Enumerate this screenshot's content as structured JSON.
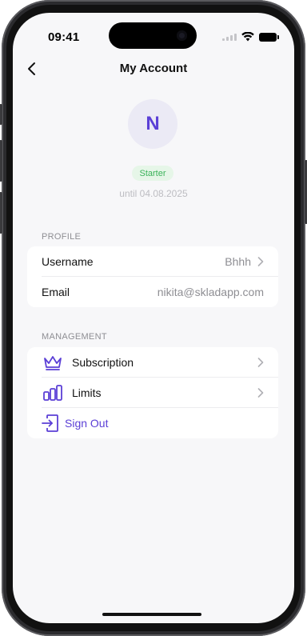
{
  "status_bar": {
    "time": "09:41"
  },
  "nav": {
    "title": "My Account"
  },
  "profile": {
    "avatar_letter": "N",
    "plan": "Starter",
    "until": "until 04.08.2025"
  },
  "profile_section": {
    "label": "PROFILE",
    "rows": [
      {
        "label": "Username",
        "value": "Bhhh"
      },
      {
        "label": "Email",
        "value": "nikita@skladapp.com"
      }
    ]
  },
  "management_section": {
    "label": "MANAGEMENT",
    "rows": [
      {
        "label": "Subscription",
        "icon": "crown-icon"
      },
      {
        "label": "Limits",
        "icon": "bar-chart-icon"
      },
      {
        "label": "Sign Out",
        "icon": "sign-out-icon"
      }
    ]
  },
  "colors": {
    "accent": "#5b3fd6",
    "badge_bg": "#e6f6e8",
    "badge_text": "#3bb35a",
    "background": "#f7f7f9"
  }
}
